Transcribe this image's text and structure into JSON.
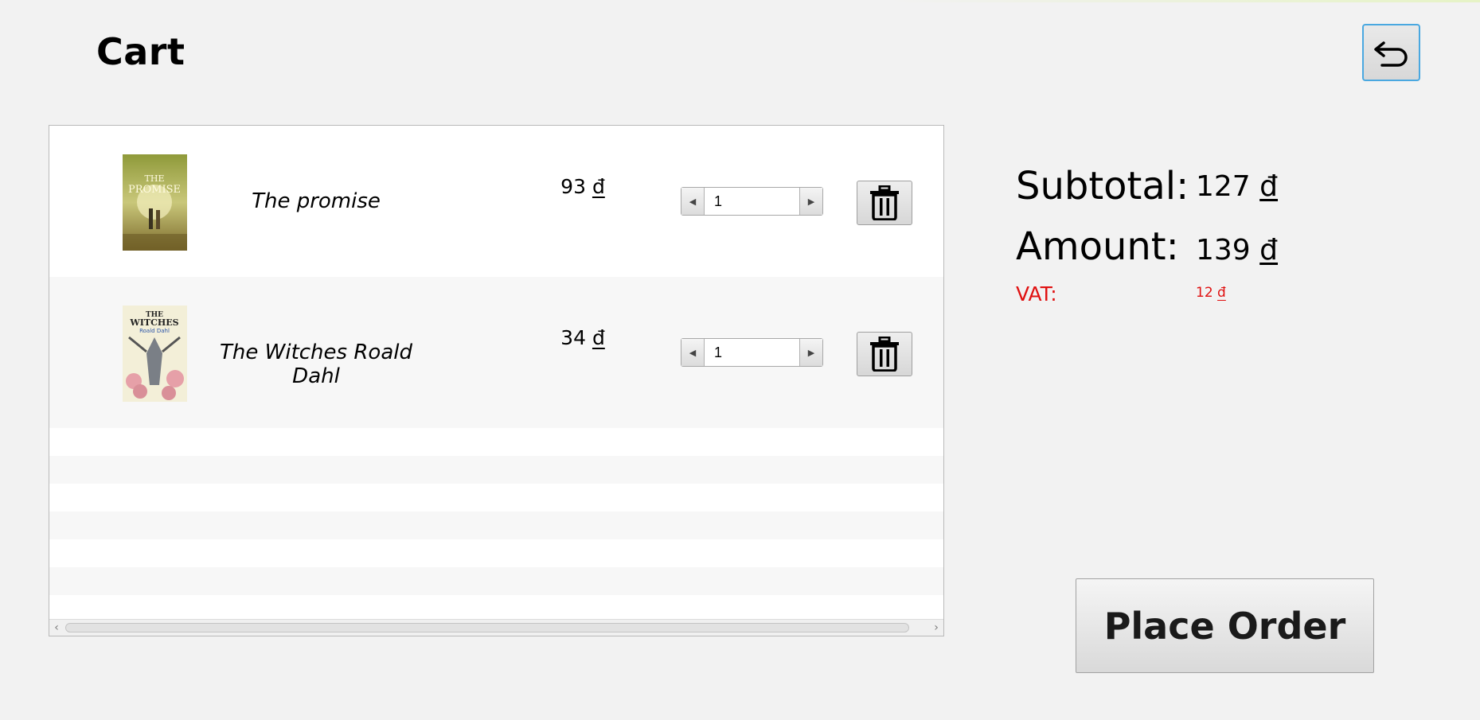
{
  "page": {
    "title": "Cart"
  },
  "icons": {
    "back": "undo-arrow-icon",
    "delete": "trash-icon",
    "step_down": "triangle-left-icon",
    "step_up": "triangle-right-icon"
  },
  "cart": {
    "items": [
      {
        "title": "The promise",
        "price_amount": "93",
        "currency": "đ",
        "quantity": "1",
        "cover_text": "THE PROMISE"
      },
      {
        "title": "The Witches Roald Dahl",
        "price_amount": "34",
        "currency": "đ",
        "quantity": "1",
        "cover_text": "THE WITCHES"
      }
    ]
  },
  "summary": {
    "subtotal_label": "Subtotal:",
    "subtotal_amount": "127",
    "amount_label": "Amount:",
    "amount_amount": "139",
    "vat_label": "VAT:",
    "vat_amount": "12",
    "currency": "đ"
  },
  "actions": {
    "place_order": "Place Order"
  },
  "colors": {
    "vat": "#e01010",
    "back_border": "#4aa8e0",
    "background": "#f2f2f2"
  }
}
